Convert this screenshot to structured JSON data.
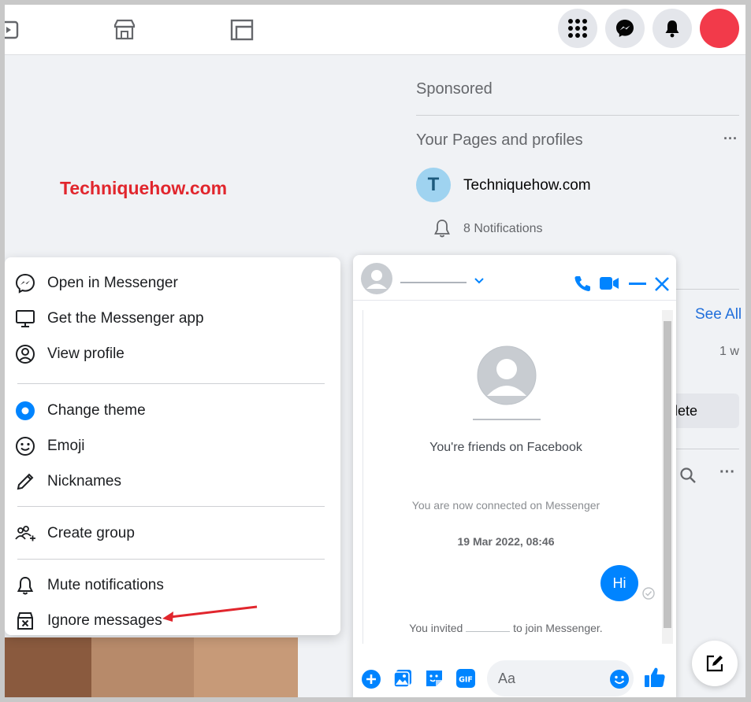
{
  "watermark": "Techniquehow.com",
  "right_column": {
    "sponsored_title": "Sponsored",
    "pages_title": "Your Pages and profiles",
    "more_label": "···",
    "page_initial": "T",
    "page_name": "Techniquehow.com",
    "notifications_label": "8 Notifications",
    "see_all_label": "See All",
    "time_label": "1 w",
    "delete_label": "lete"
  },
  "context_menu": {
    "items": [
      {
        "label": "Open in Messenger",
        "icon": "messenger-icon"
      },
      {
        "label": "Get the Messenger app",
        "icon": "monitor-icon"
      },
      {
        "label": "View profile",
        "icon": "user-circle-icon"
      },
      {
        "label": "Change theme",
        "icon": "theme-dot-icon"
      },
      {
        "label": "Emoji",
        "icon": "smiley-icon"
      },
      {
        "label": "Nicknames",
        "icon": "pencil-icon"
      },
      {
        "label": "Create group",
        "icon": "group-add-icon"
      },
      {
        "label": "Mute notifications",
        "icon": "bell-icon"
      },
      {
        "label": "Ignore messages",
        "icon": "ignore-icon"
      }
    ]
  },
  "chat": {
    "friends_text": "You're friends on Facebook",
    "connected_text": "You are now connected on Messenger",
    "timestamp": "19 Mar 2022, 08:46",
    "message": "Hi",
    "invite_prefix": "You invited",
    "invite_suffix": "to join Messenger.",
    "composer_placeholder": "Aa"
  },
  "colors": {
    "messenger_blue": "#0084ff",
    "watermark_red": "#e1262d",
    "avatar_red": "#f23a4a"
  }
}
